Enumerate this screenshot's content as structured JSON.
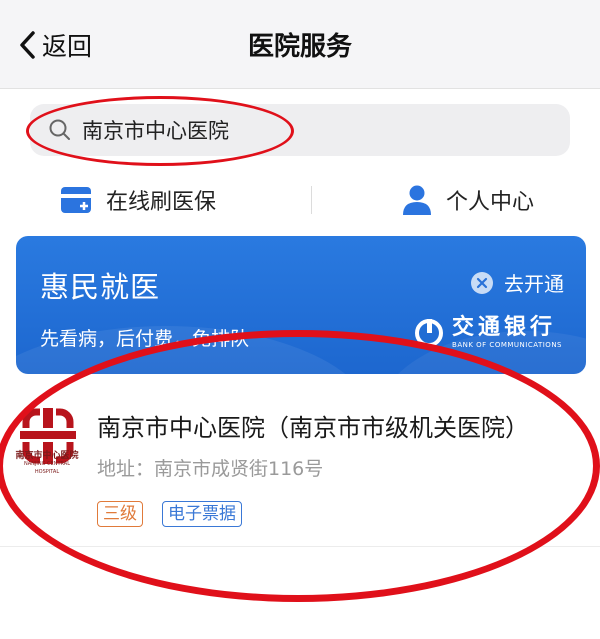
{
  "nav": {
    "back_label": "返回",
    "title": "医院服务"
  },
  "search": {
    "value": "南京市中心医院"
  },
  "quick_actions": [
    {
      "label": "在线刷医保",
      "icon": "card-icon"
    },
    {
      "label": "个人中心",
      "icon": "user-icon"
    }
  ],
  "banner": {
    "title": "惠民就医",
    "subtitle": "先看病，后付费，免排队",
    "action_label": "去开通",
    "bank_name": "交通银行",
    "bank_english": "BANK OF COMMUNICATIONS"
  },
  "hospital": {
    "name": "南京市中心医院（南京市市级机关医院）",
    "address": "地址：南京市成贤街116号",
    "logo_text": "南京市中心医院",
    "logo_en": "NANJING CENTRAL HOSPITAL",
    "tags": [
      "三级",
      "电子票据"
    ]
  },
  "colors": {
    "accent": "#1d67cf",
    "annotation": "#e0101a",
    "tag_level": "#e07a3a",
    "tag_receipt": "#3a78d6"
  }
}
